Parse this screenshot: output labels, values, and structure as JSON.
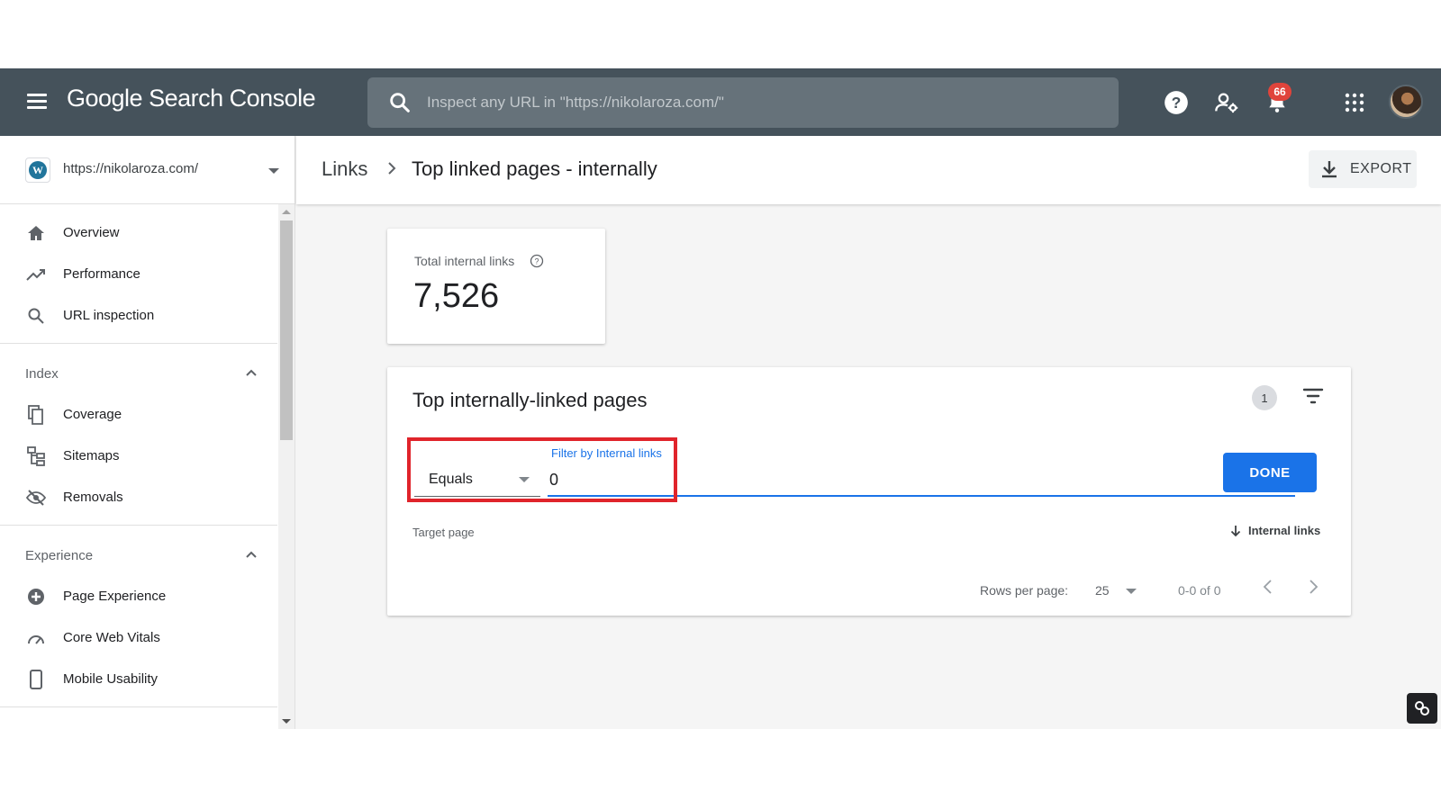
{
  "topbar": {
    "brand": "Google Search Console",
    "search_placeholder": "Inspect any URL in \"https://nikolaroza.com/\"",
    "notification_count": "66"
  },
  "sidebar": {
    "property_url": "https://nikolaroza.com/",
    "top_items": [
      {
        "label": "Overview",
        "icon": "home-icon"
      },
      {
        "label": "Performance",
        "icon": "trending-up-icon"
      },
      {
        "label": "URL inspection",
        "icon": "search-icon"
      }
    ],
    "index_section": {
      "title": "Index",
      "items": [
        {
          "label": "Coverage",
          "icon": "coverage-icon"
        },
        {
          "label": "Sitemaps",
          "icon": "sitemap-icon"
        },
        {
          "label": "Removals",
          "icon": "eye-off-icon"
        }
      ]
    },
    "experience_section": {
      "title": "Experience",
      "items": [
        {
          "label": "Page Experience",
          "icon": "page-experience-icon"
        },
        {
          "label": "Core Web Vitals",
          "icon": "speedometer-icon"
        },
        {
          "label": "Mobile Usability",
          "icon": "phone-icon"
        }
      ]
    }
  },
  "header": {
    "breadcrumb_parent": "Links",
    "breadcrumb_current": "Top linked pages - internally",
    "export_label": "EXPORT"
  },
  "summary": {
    "label": "Total internal links",
    "value": "7,526"
  },
  "table": {
    "title": "Top internally-linked pages",
    "active_filter_count": "1",
    "filter_label": "Filter by Internal links",
    "operator": "Equals",
    "filter_value": "0",
    "done_label": "DONE",
    "col_target": "Target page",
    "col_internal": "Internal links",
    "rows_per_page_label": "Rows per page:",
    "rows_per_page": "25",
    "range": "0-0 of 0"
  },
  "colors": {
    "topbar": "#45525b",
    "accent": "#1a73e8",
    "highlight": "#e0242b"
  }
}
